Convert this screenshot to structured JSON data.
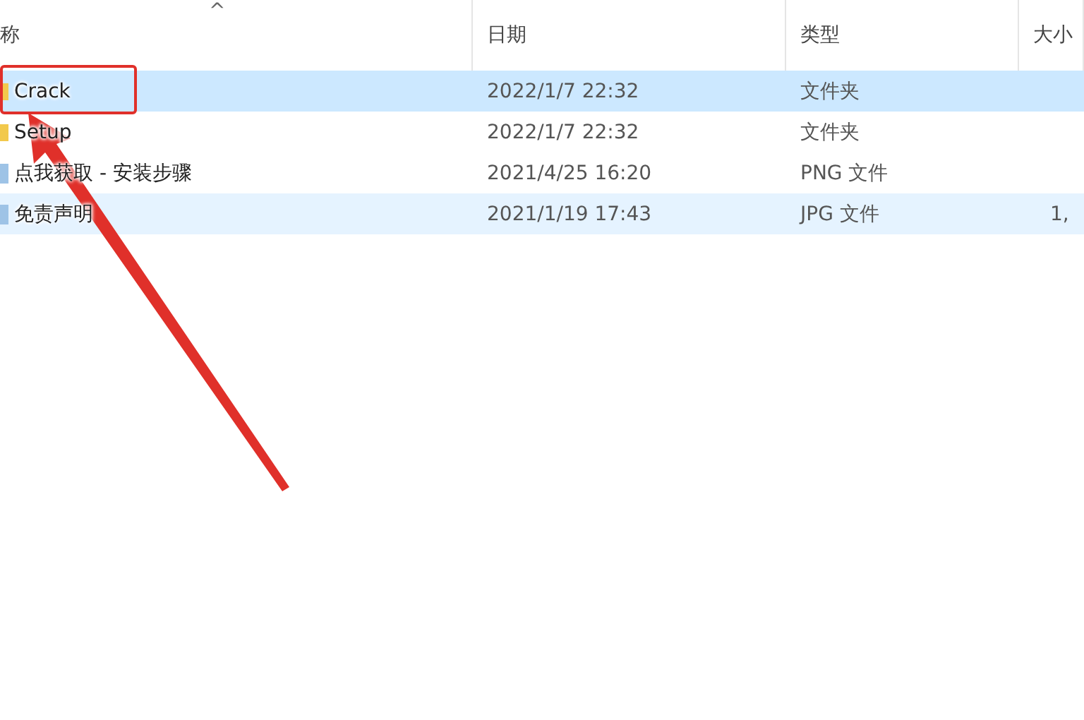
{
  "table": {
    "sort_indicator": "^",
    "columns": [
      "称",
      "日期",
      "类型",
      "大小"
    ],
    "rows": [
      {
        "kind": "folder",
        "name": "Crack",
        "date": "2022/1/7 22:32",
        "type": "文件夹",
        "size": "",
        "selected": true,
        "hovered": false,
        "annotated": true
      },
      {
        "kind": "folder",
        "name": "Setup",
        "date": "2022/1/7 22:32",
        "type": "文件夹",
        "size": "",
        "selected": false,
        "hovered": false,
        "annotated": false
      },
      {
        "kind": "image",
        "name": "点我获取 - 安装步骤",
        "date": "2021/4/25 16:20",
        "type": "PNG 文件",
        "size": "",
        "selected": false,
        "hovered": false,
        "annotated": false
      },
      {
        "kind": "image",
        "name": "免责声明",
        "date": "2021/1/19 17:43",
        "type": "JPG 文件",
        "size": "1,",
        "selected": false,
        "hovered": true,
        "annotated": false
      }
    ]
  }
}
